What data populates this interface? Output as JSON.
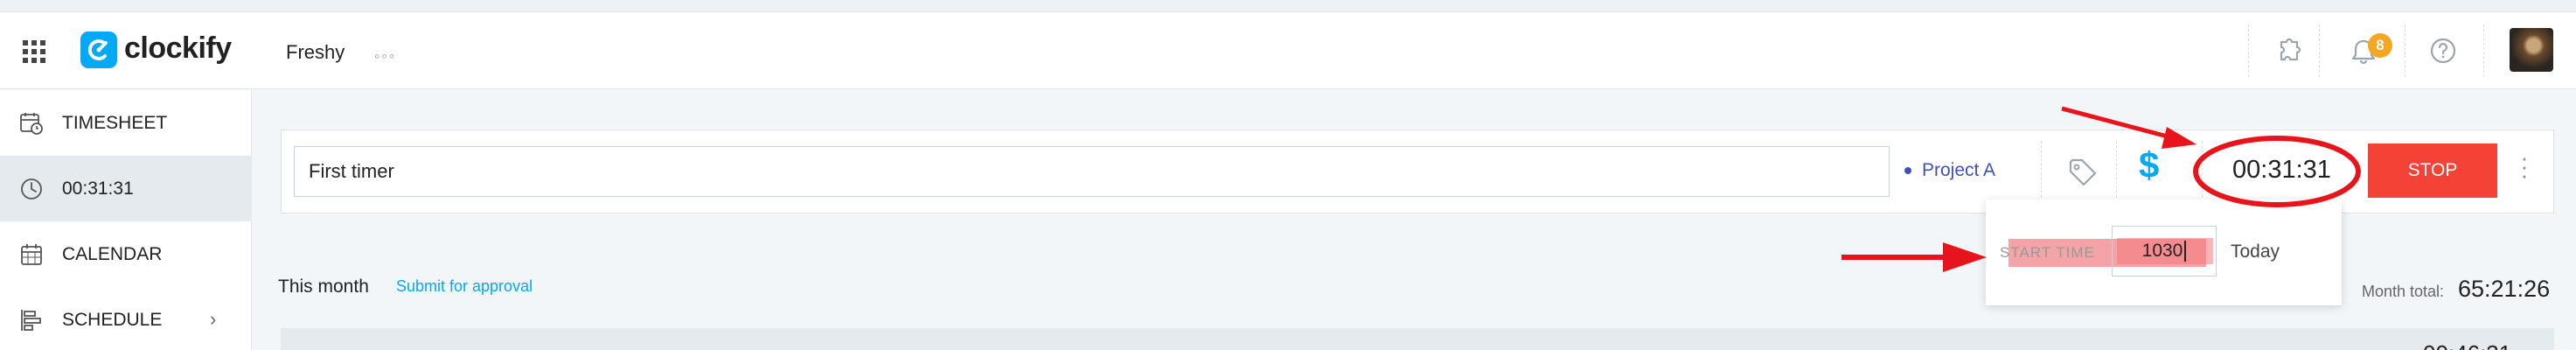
{
  "header": {
    "logo_text": "clockify",
    "workspace": "Freshy",
    "more_menu": "◦◦◦",
    "notification_count": "8"
  },
  "sidebar": {
    "items": [
      {
        "label": "TIMESHEET",
        "icon": "calendar-clock-icon"
      },
      {
        "label": "00:31:31",
        "icon": "clock-icon"
      },
      {
        "label": "CALENDAR",
        "icon": "calendar-icon"
      },
      {
        "label": "SCHEDULE",
        "icon": "schedule-icon"
      }
    ]
  },
  "timer": {
    "description": "First timer",
    "project": "Project A",
    "elapsed": "00:31:31",
    "stop_label": "STOP",
    "billable_symbol": "$"
  },
  "start_popover": {
    "label": "START TIME",
    "value": "1030",
    "day": "Today"
  },
  "summary": {
    "period": "This month",
    "submit_label": "Submit for approval",
    "month_total_label": "Month total:",
    "month_total_value": "65:21:26"
  },
  "colors": {
    "brand": "#03a9f4",
    "stop": "#f44336",
    "project": "#3f51b5",
    "badge": "#f5a623",
    "annotation": "#e8141b"
  }
}
